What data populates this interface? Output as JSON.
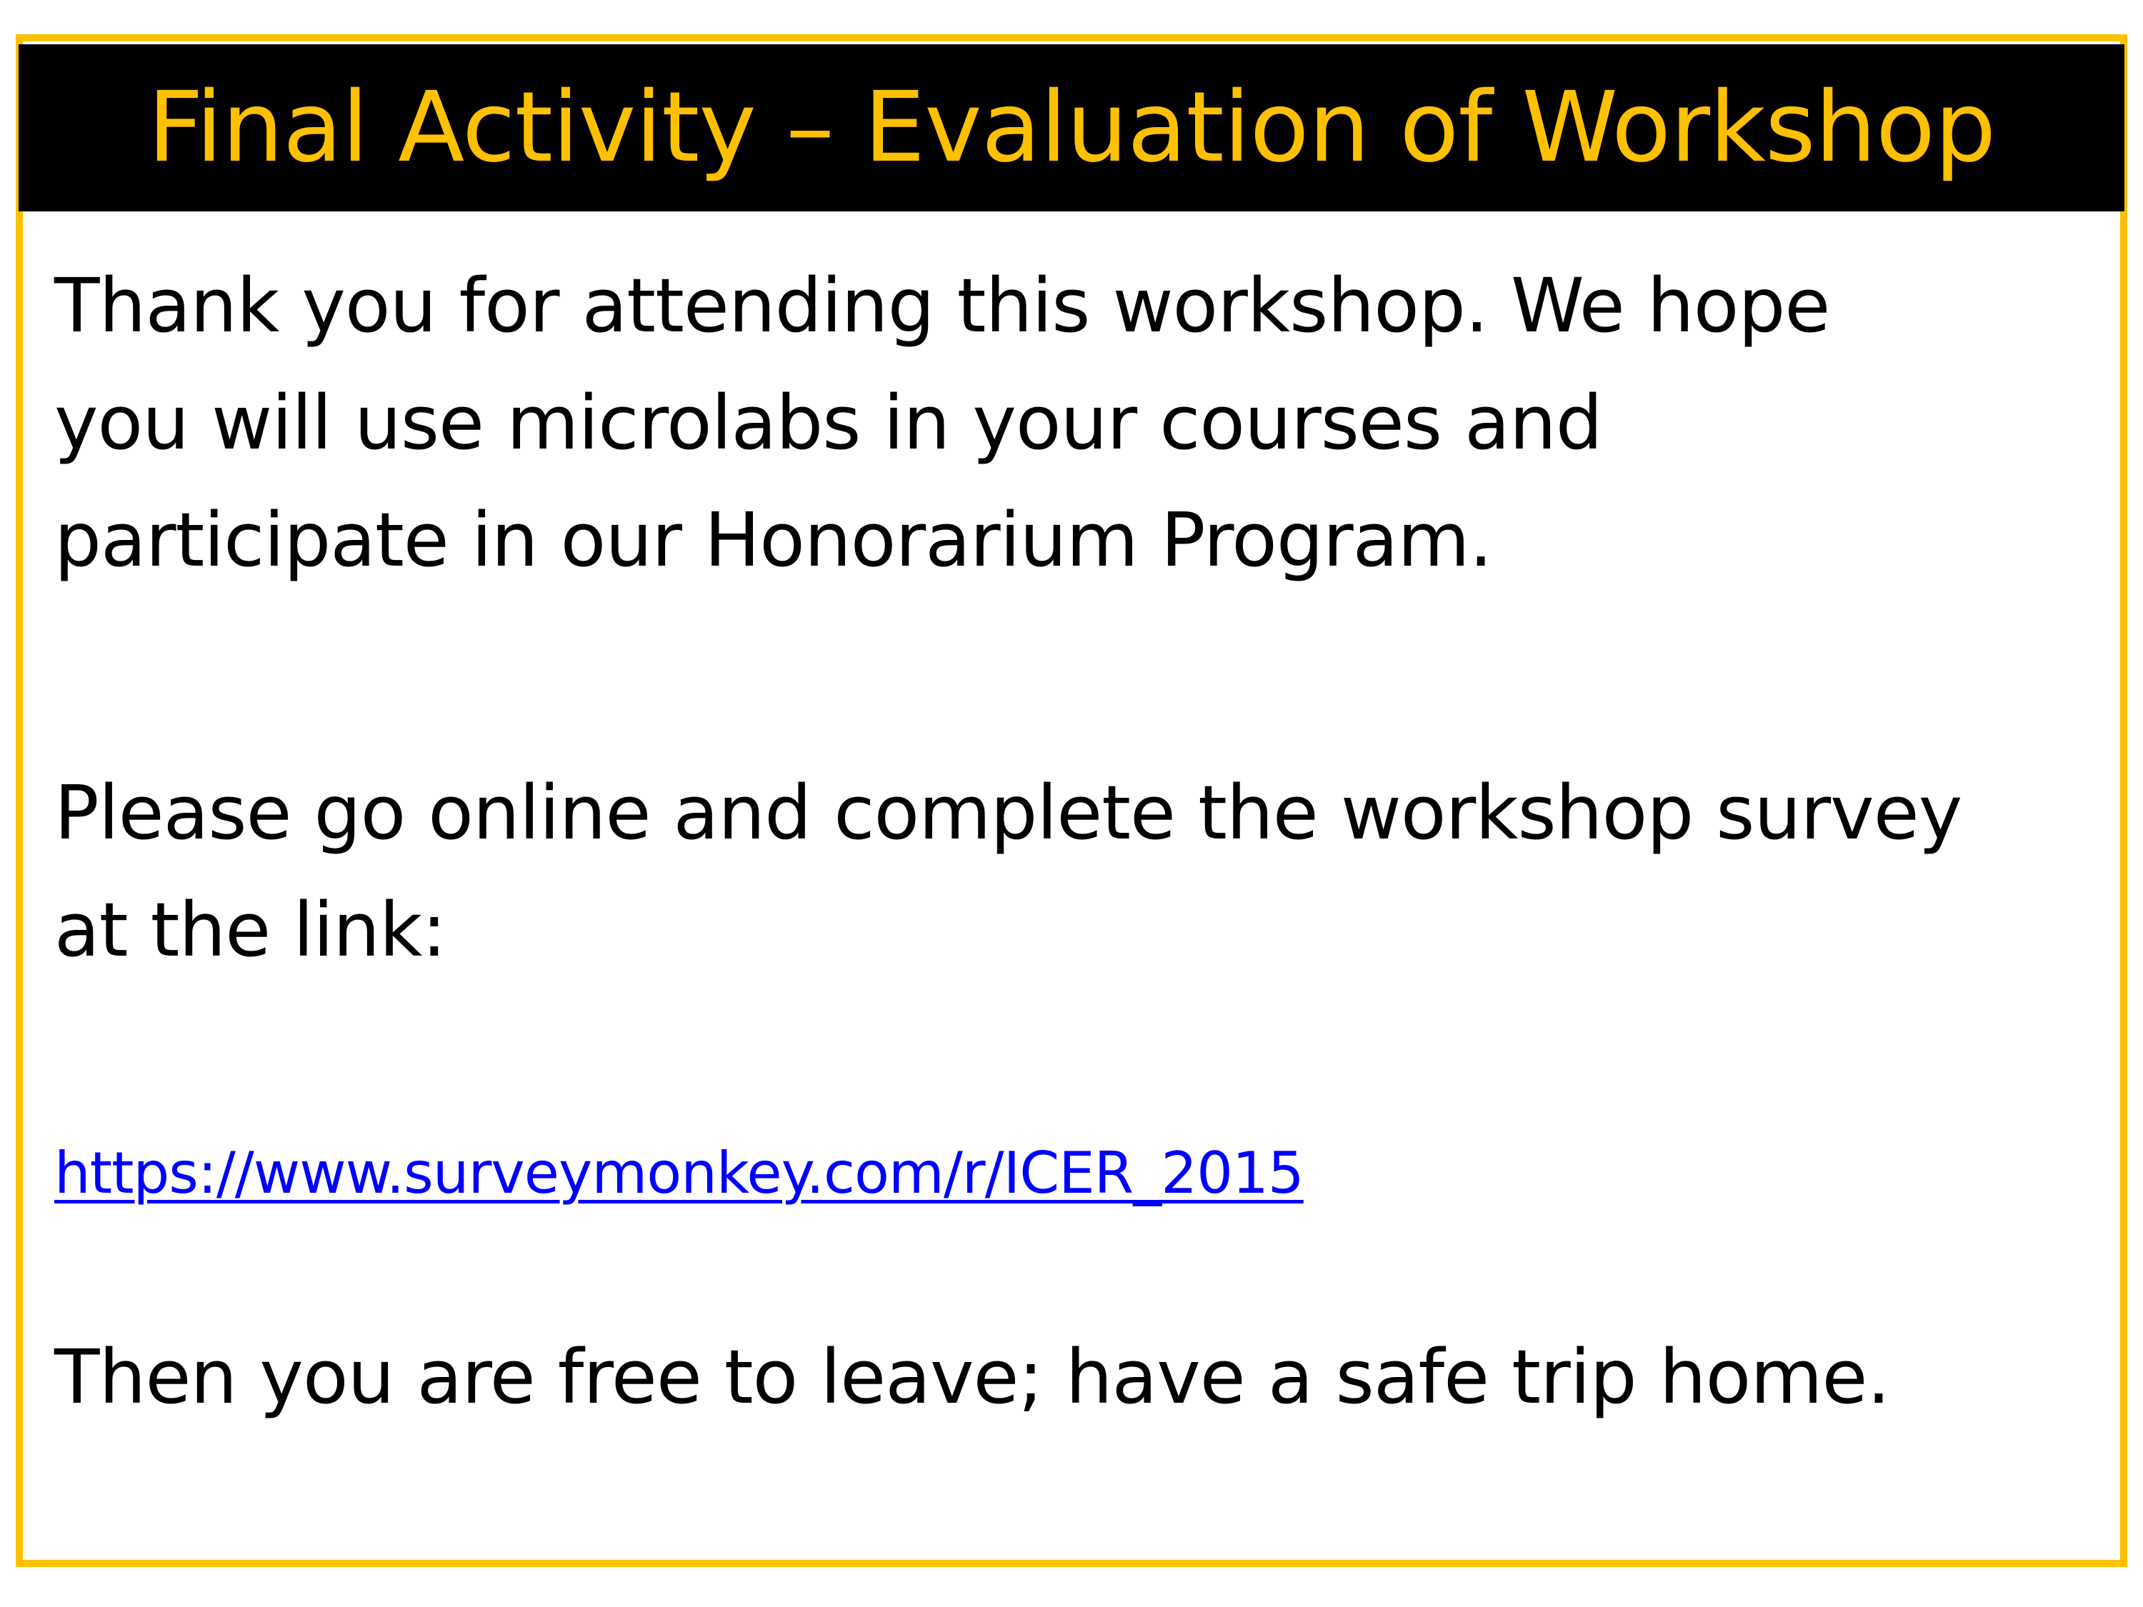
{
  "slide": {
    "title": "Final Activity – Evaluation of Workshop",
    "paragraph1": {
      "lines": [
        "Thank you for attending this workshop.  We hope",
        "you will use microlabs in your courses and",
        "participate in our Honorarium Program."
      ]
    },
    "paragraph2": {
      "lines": [
        "Please go online and complete the workshop survey",
        "at the link:"
      ]
    },
    "link": {
      "text": "https://www.surveymonkey.com/r/ICER_2015"
    },
    "paragraph3": {
      "text": "Then you are free to leave; have a safe trip home."
    }
  },
  "colors": {
    "accent": "#ffc000",
    "title_bar": "#000000",
    "link": "#0000ff",
    "text": "#000000",
    "background": "#ffffff"
  }
}
